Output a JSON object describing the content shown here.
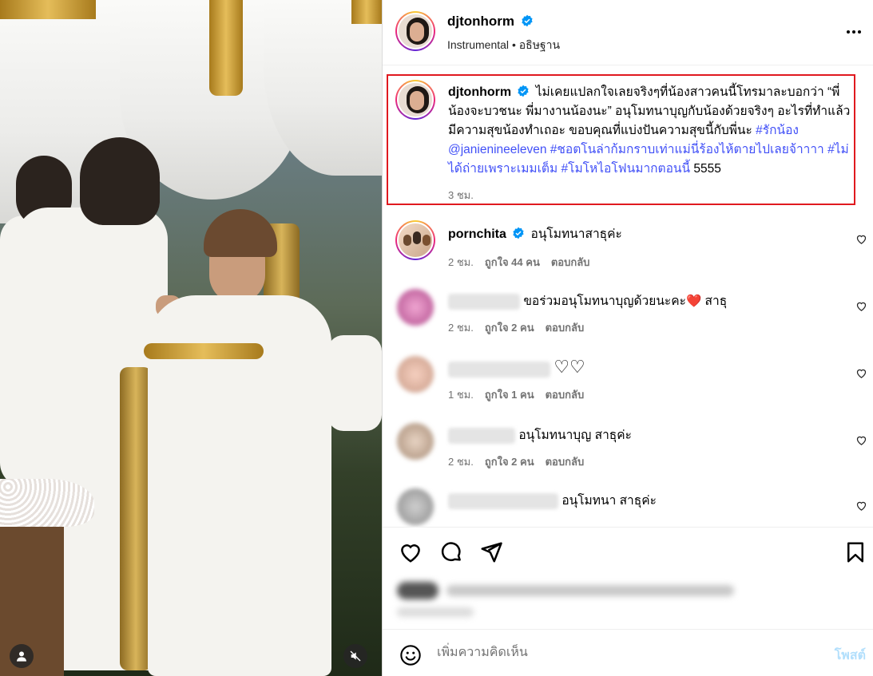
{
  "post": {
    "username": "djtonhorm",
    "audio": "Instrumental",
    "location": "อธิษฐาน",
    "caption_parts": [
      {
        "text": "ไม่เคยแปลกใจเลยจริงๆที่น้องสาวคนนี้โทรมาละบอกว่า “พี่น้องจะบวชนะ พี่มางานน้องนะ” อนุโมทนาบุญกับน้องด้วยจริงๆ อะไรที่ทำแล้วมีความสุขน้องทำเถอะ ขอบคุณที่แบ่งปันความสุขนี้กับพี่นะ ",
        "link": false
      },
      {
        "text": "#รักน้อง @janienineeleven #ชอตโนล่าก้มกราบเท่าแม่นี่ร้องไห้ตายไปเลยจ้าาาา #ไม่ได้ถ่ายเพราะเมมเต็ม #โมโหไอโฟนมากตอนนี้",
        "link": true
      },
      {
        "text": " 5555",
        "link": false
      }
    ],
    "caption_time": "3 ชม."
  },
  "comments": [
    {
      "username": "pornchita",
      "verified": true,
      "text": "อนุโมทนาสาธุค่ะ",
      "time": "2 ชม.",
      "likes": "ถูกใจ 44 คน",
      "reply": "ตอบกลับ"
    },
    {
      "username": "",
      "verified": false,
      "text": "ขอร่วมอนุโมทนาบุญด้วยนะคะ❤️ สาธุ",
      "time": "2 ชม.",
      "likes": "ถูกใจ 2 คน",
      "reply": "ตอบกลับ"
    },
    {
      "username": "",
      "verified": false,
      "text": "♡♡",
      "time": "1 ชม.",
      "likes": "ถูกใจ 1 คน",
      "reply": "ตอบกลับ"
    },
    {
      "username": "",
      "verified": false,
      "text": "อนุโมทนาบุญ สาธุค่ะ",
      "time": "2 ชม.",
      "likes": "ถูกใจ 2 คน",
      "reply": "ตอบกลับ"
    },
    {
      "username": "",
      "verified": false,
      "text": "อนุโมทนา สาธุค่ะ",
      "time": "",
      "likes": "",
      "reply": ""
    }
  ],
  "composer": {
    "placeholder": "เพิ่มความคิดเห็น",
    "post_label": "โพสต์"
  },
  "colors": {
    "highlight_border": "#e0191f",
    "link": "#4150f7",
    "verified": "#0095f6"
  },
  "icons": [
    "more-icon",
    "verified-icon",
    "heart-icon",
    "comment-icon",
    "share-icon",
    "bookmark-icon",
    "emoji-icon",
    "user-tag-icon",
    "mute-icon"
  ]
}
